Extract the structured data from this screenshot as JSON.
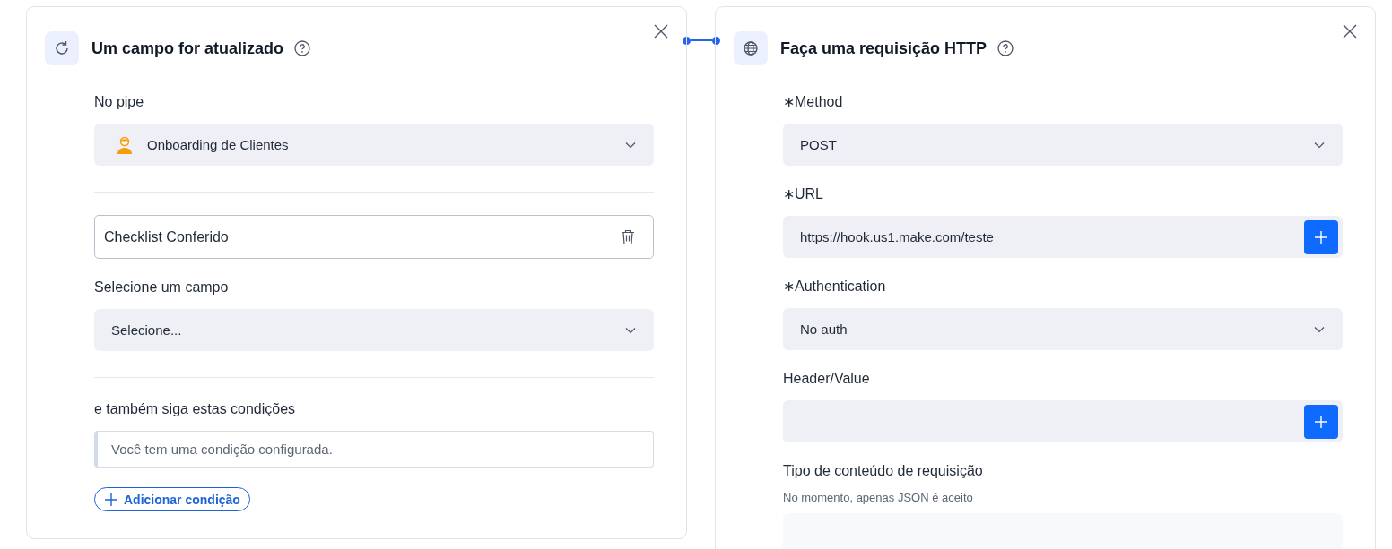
{
  "trigger_card": {
    "title": "Um campo for atualizado",
    "fields": [
      {
        "kind": "select",
        "label": "No pipe",
        "value": "Onboarding de Clientes",
        "pipe_icon": true
      },
      {
        "kind": "divider"
      },
      {
        "kind": "removable",
        "value": "Checklist Conferido"
      },
      {
        "kind": "select",
        "label": "Selecione um campo",
        "value": "Selecione...",
        "pipe_icon": false
      },
      {
        "kind": "divider"
      },
      {
        "kind": "note",
        "label": "e também siga estas condições",
        "value": "Você tem uma condição configurada."
      },
      {
        "kind": "add_button",
        "value": "Adicionar condição"
      }
    ]
  },
  "action_card": {
    "title": "Faça uma requisição HTTP",
    "fields": [
      {
        "kind": "select",
        "label": "∗Method",
        "value": "POST"
      },
      {
        "kind": "input_add",
        "label": "∗URL",
        "value": "https://hook.us1.make.com/teste"
      },
      {
        "kind": "select",
        "label": "∗Authentication",
        "value": "No auth"
      },
      {
        "kind": "input_add",
        "label": "Header/Value"
      },
      {
        "kind": "hint_block",
        "label": "Tipo de conteúdo de requisição",
        "hint": "No momento, apenas JSON é aceito"
      }
    ]
  }
}
